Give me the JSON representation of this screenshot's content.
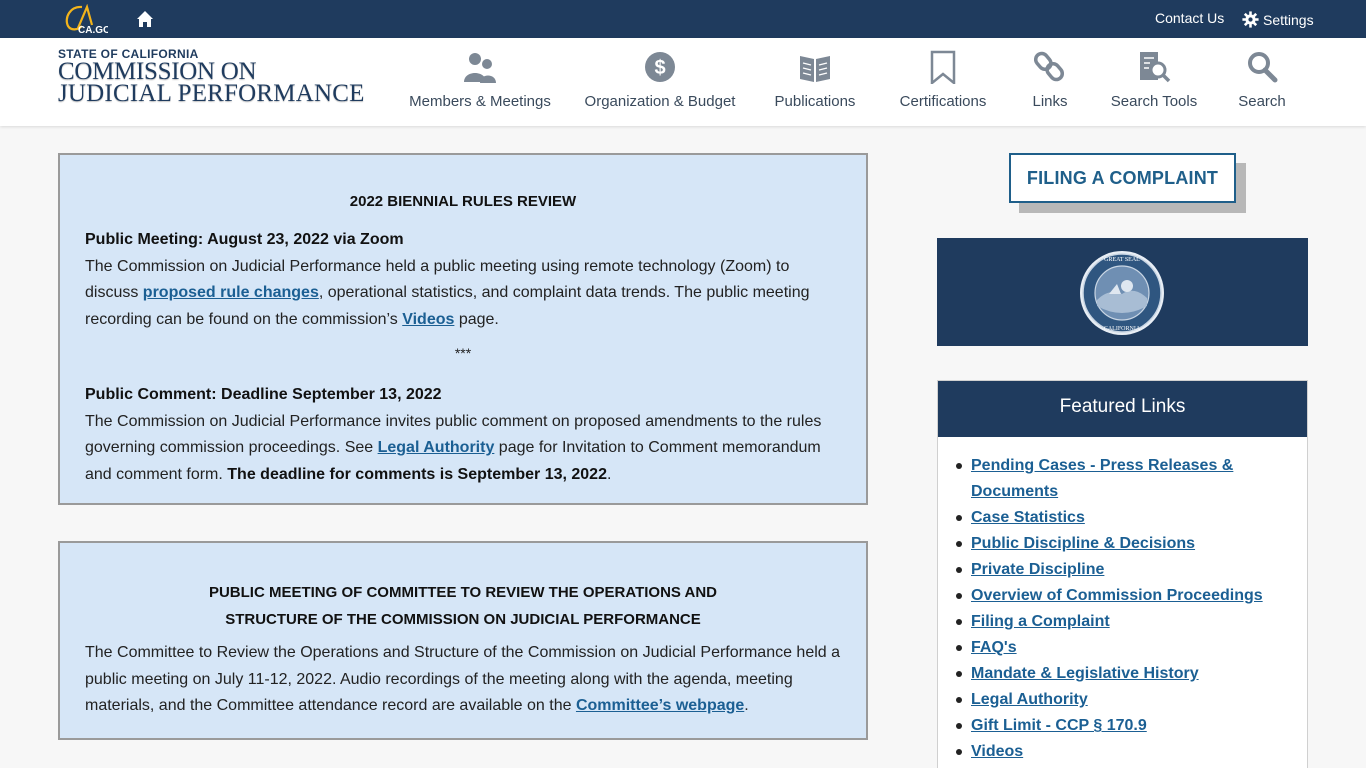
{
  "utility": {
    "logo_text": "CA.GOV",
    "contact": "Contact Us",
    "settings": "Settings"
  },
  "brand": {
    "line1": "STATE OF CALIFORNIA",
    "line2": "COMMISSION ON",
    "line3": "JUDICIAL PERFORMANCE"
  },
  "nav": [
    {
      "label": "Members & Meetings",
      "icon": "people-icon"
    },
    {
      "label": "Organization & Budget",
      "icon": "dollar-icon"
    },
    {
      "label": "Publications",
      "icon": "book-icon"
    },
    {
      "label": "Certifications",
      "icon": "bookmark-icon"
    },
    {
      "label": "Links",
      "icon": "link-icon"
    },
    {
      "label": "Search Tools",
      "icon": "search-document-icon"
    },
    {
      "label": "Search",
      "icon": "search-icon"
    }
  ],
  "box1": {
    "title": "2022 BIENNIAL RULES REVIEW",
    "meeting_heading": "Public Meeting: August 23, 2022 via Zoom",
    "meeting_text_1": "The Commission on Judicial Performance held a public meeting using remote technology (Zoom) to discuss ",
    "meeting_link_1": "proposed rule changes",
    "meeting_text_2": ", operational statistics, and complaint data trends. The public meeting recording can be found on the commission’s ",
    "meeting_link_2": "Videos",
    "meeting_text_3": " page.",
    "separator": "***",
    "comment_heading": "Public Comment: Deadline September 13, 2022",
    "comment_text_1": "The Commission on Judicial Performance invites public comment on proposed amendments to the rules governing commission proceedings. See ",
    "comment_link": "Legal Authority",
    "comment_text_2": " page for Invitation to Comment memorandum and comment form. ",
    "comment_bold": "The deadline for comments is September 13, 2022",
    "comment_end": "."
  },
  "box2": {
    "title_line1": "PUBLIC MEETING OF COMMITTEE TO REVIEW THE OPERATIONS AND",
    "title_line2": "STRUCTURE OF THE COMMISSION ON JUDICIAL PERFORMANCE",
    "text_1": "The Committee to Review the Operations and Structure of the Commission on Judicial Performance held a public meeting on July 11-12, 2022.  Audio recordings of the meeting along with the agenda, meeting materials, and the Committee attendance record are available on the ",
    "link": "Committee’s webpage",
    "text_2": "."
  },
  "sidebar": {
    "filing_button": "FILING A COMPLAINT",
    "seal_text": "GREAT SEAL OF THE STATE OF CALIFORNIA",
    "featured_title": "Featured Links",
    "links": [
      "Pending Cases - Press Releases & Documents",
      "Case Statistics",
      "Public Discipline & Decisions",
      "Private Discipline",
      "Overview of Commission Proceedings",
      "Filing a Complaint",
      "FAQ's",
      "Mandate & Legislative History",
      "Legal Authority",
      "Gift Limit - CCP § 170.9",
      "Videos"
    ]
  },
  "colors": {
    "navy": "#1f3b5e",
    "box_bg": "#d6e6f7",
    "link": "#1b5f93",
    "accent_gold": "#f3b41b"
  }
}
